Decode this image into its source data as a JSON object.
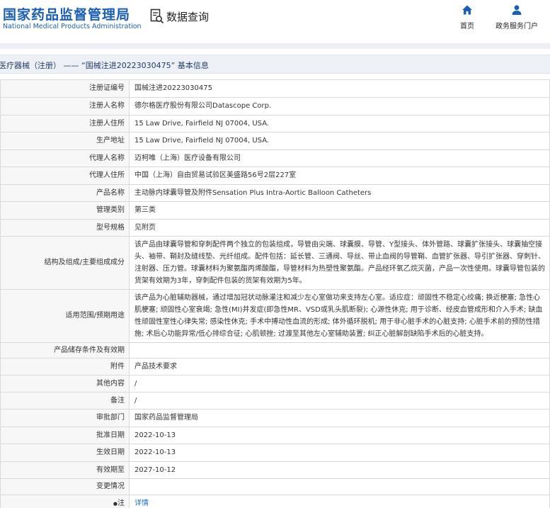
{
  "header": {
    "logo_cn": "国家药品监督管理局",
    "logo_en": "National Medical Products Administration",
    "query_label": "数据查询",
    "nav": [
      {
        "label": "首页",
        "icon": "home-icon"
      },
      {
        "label": "政务服务门户",
        "icon": "user-icon"
      }
    ],
    "brand_color": "#1a5fb4"
  },
  "breadcrumb": "医疗器械（注册） —— “国械注进20223030475” 基本信息",
  "rows": [
    {
      "key": "注册证编号",
      "value": "国械注进20223030475"
    },
    {
      "key": "注册人名称",
      "value": "德尔格医疗股份有限公司Datascope Corp."
    },
    {
      "key": "注册人住所",
      "value": "15 Law Drive, Fairfield NJ 07004, USA."
    },
    {
      "key": "生产地址",
      "value": "15 Law Drive, Fairfield NJ 07004, USA."
    },
    {
      "key": "代理人名称",
      "value": "迈柯唯（上海）医疗设备有限公司"
    },
    {
      "key": "代理人住所",
      "value": "中国（上海）自由贸易试验区美盛路56号2层227室"
    },
    {
      "key": "产品名称",
      "value": "主动脉内球囊导管及附件Sensation Plus Intra-Aortic Balloon Catheters"
    },
    {
      "key": "管理类别",
      "value": "第三类"
    },
    {
      "key": "型号规格",
      "value": "见附页"
    },
    {
      "key": "结构及组成/主要组成成分",
      "value": "该产品由球囊导管和穿刺配件两个独立的包装组成，导管由尖端、球囊膜、导管、Y型接头、体外管路、球囊扩张接头、球囊抽空接头、袖带、鞘封及缝线垫、光纤组成。配件包括：延长管、三通阀、导丝、带止血阀的导管鞘、血管扩张器、导引扩张器、穿刺针、注射器、压力管。球囊材料为聚氨酯丙烯酸酯，导管材料为热塑性聚氨酯。产品经环氧乙烷灭菌，产品一次性使用。球囊导管包装的货架有效期为3年，穿刺配件包装的货架有效期为5年。"
    },
    {
      "key": "适用范围/预期用途",
      "value": "该产品为心脏辅助器械，通过增加冠状动脉灌注和减少左心室做功来支持左心室。适应症：顽固性不稳定心绞痛; 换近梗塞; 急性心肌梗塞; 顽固性心室衰竭; 急性(MI)并发症(即急性MR、VSD或乳头肌断裂); 心源性休克; 用于诊断、经皮血管成形和介入手术; 缺血性顽固性室性心律失常; 感染性休克; 手术中搏动性血流的形成; 体外循环脱机; 用于非心脏手术的心脏支持; 心脏手术前的预防性措施; 术后心功能异常/低心排综合征; 心肌顿挫; 过渡至其他左心室辅助装置; 纠正心脏解剖缺陷手术后的心脏支持。"
    },
    {
      "key": "产品储存条件及有效期",
      "value": ""
    },
    {
      "key": "附件",
      "value": "产品技术要求"
    },
    {
      "key": "其他内容",
      "value": "/"
    },
    {
      "key": "备注",
      "value": "/"
    },
    {
      "key": "审批部门",
      "value": "国家药品监督管理局"
    },
    {
      "key": "批准日期",
      "value": "2022-10-13"
    },
    {
      "key": "生效日期",
      "value": "2022-10-13"
    },
    {
      "key": "有效期至",
      "value": "2027-10-12"
    },
    {
      "key": "变更情况",
      "value": ""
    }
  ],
  "note_row": {
    "key": "注",
    "link": "详情"
  }
}
